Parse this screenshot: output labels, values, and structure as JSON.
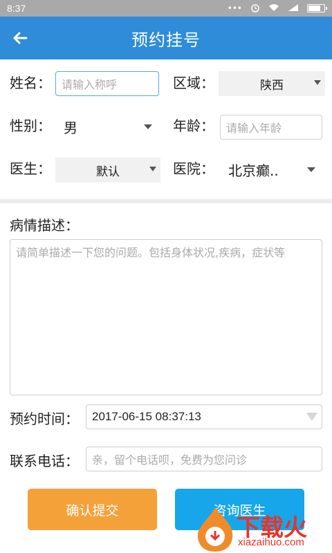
{
  "status_bar": {
    "time": "8:37",
    "icons": [
      "dots-icon",
      "alarm-icon",
      "wifi-icon",
      "signal-icon",
      "battery-icon"
    ]
  },
  "app_bar": {
    "title": "预约挂号",
    "back_icon": "arrow-left-icon"
  },
  "form": {
    "name": {
      "label": "姓名：",
      "placeholder": "请输入称呼",
      "value": ""
    },
    "region": {
      "label": "区域：",
      "value": "陕西"
    },
    "gender": {
      "label": "性别：",
      "value": "男"
    },
    "age": {
      "label": "年龄：",
      "placeholder": "请输入年龄",
      "value": ""
    },
    "doctor": {
      "label": "医生：",
      "value": "默认"
    },
    "hospital": {
      "label": "医院：",
      "value": "北京癫.."
    },
    "description": {
      "label": "病情描述：",
      "placeholder": "请简单描述一下您的问题。包括身体状况,疾病，症状等"
    },
    "appointment_time": {
      "label": "预约时间：",
      "value": "2017-06-15 08:37:13"
    },
    "phone": {
      "label": "联系电话：",
      "placeholder": "亲，留个电话呗，免费为您问诊"
    }
  },
  "buttons": {
    "submit": "确认提交",
    "consult": "咨询医生"
  },
  "watermark": {
    "cn": "下载火",
    "en": "xiazaihuo.com"
  },
  "colors": {
    "appbar": "#2f8cd8",
    "submit": "#f5a13a",
    "consult": "#17a6e9",
    "statusbar": "#a9a9a9"
  }
}
